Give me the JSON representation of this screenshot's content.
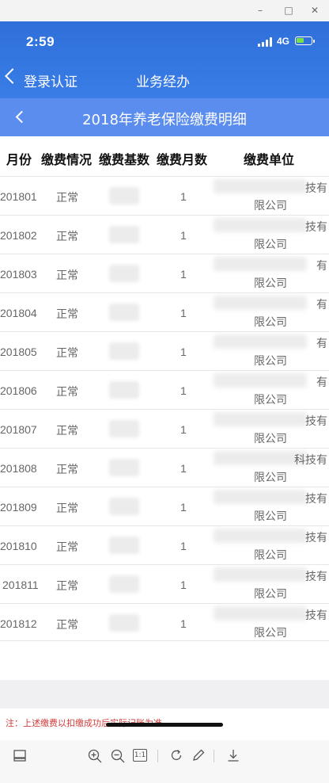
{
  "window": {
    "minimize": "–",
    "maximize": "□",
    "close": "✕"
  },
  "status_bar": {
    "time": "2:59",
    "network": "4G"
  },
  "nav": {
    "back_label": "登录认证",
    "title": "业务经办"
  },
  "page": {
    "title": "2018年养老保险缴费明细"
  },
  "table": {
    "headers": [
      "月份",
      "缴费情况",
      "缴费基数",
      "缴费月数",
      "缴费单位"
    ],
    "rows": [
      {
        "month": "201801",
        "status": "正常",
        "months": "1",
        "unit_tail": "技有",
        "unit_line2": "限公司"
      },
      {
        "month": "201802",
        "status": "正常",
        "months": "1",
        "unit_tail": "技有",
        "unit_line2": "限公司"
      },
      {
        "month": "201803",
        "status": "正常",
        "months": "1",
        "unit_tail": "有",
        "unit_line2": "限公司"
      },
      {
        "month": "201804",
        "status": "正常",
        "months": "1",
        "unit_tail": "有",
        "unit_line2": "限公司"
      },
      {
        "month": "201805",
        "status": "正常",
        "months": "1",
        "unit_tail": "有",
        "unit_line2": "限公司"
      },
      {
        "month": "201806",
        "status": "正常",
        "months": "1",
        "unit_tail": "有",
        "unit_line2": "限公司"
      },
      {
        "month": "201807",
        "status": "正常",
        "months": "1",
        "unit_tail": "技有",
        "unit_line2": "限公司"
      },
      {
        "month": "201808",
        "status": "正常",
        "months": "1",
        "unit_tail": "科技有",
        "unit_line2": "限公司"
      },
      {
        "month": "201809",
        "status": "正常",
        "months": "1",
        "unit_tail": "技有",
        "unit_line2": "限公司"
      },
      {
        "month": "201810",
        "status": "正常",
        "months": "1",
        "unit_tail": "技有",
        "unit_line2": "限公司"
      },
      {
        "month": "201811",
        "status": "正常",
        "months": "1",
        "unit_tail": "技有",
        "unit_line2": "限公司"
      },
      {
        "month": "201812",
        "status": "正常",
        "months": "1",
        "unit_tail": "技有",
        "unit_line2": "限公司"
      }
    ]
  },
  "note": "注：上述缴费以扣缴成功后实际记账为准。",
  "toolbar": {
    "fit_label": "1:1"
  },
  "colors": {
    "app_blue": "#3a7de6",
    "header_blue": "#5b8def",
    "note_red": "#d23b3b"
  }
}
